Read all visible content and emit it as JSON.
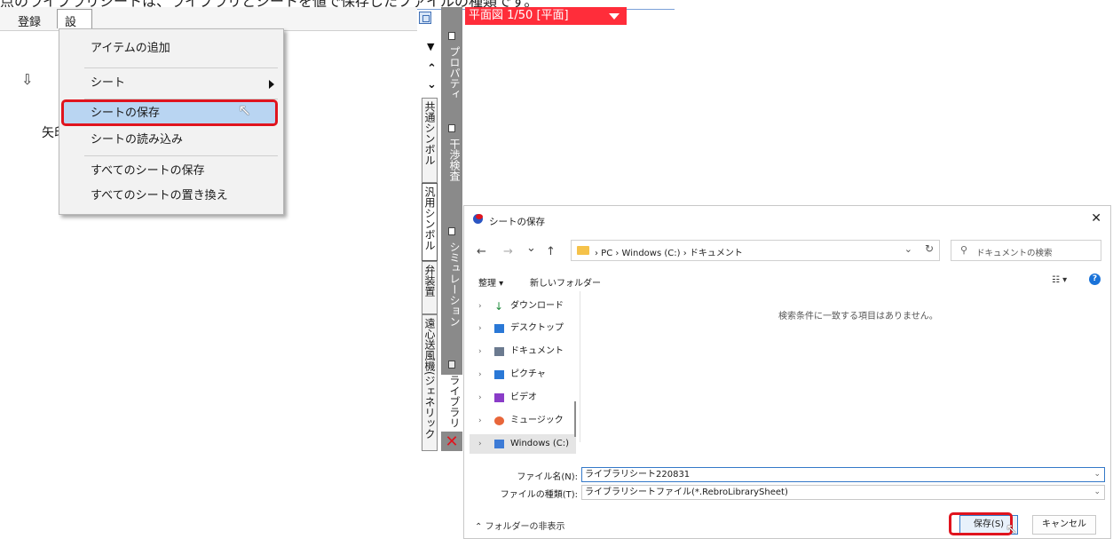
{
  "caption": "点のライブラリシートは、ライブラリとシートを値で保存したファイルの種類です。",
  "menubar": {
    "register": "登録",
    "settings": "設定"
  },
  "dropdown": {
    "items": [
      {
        "label": "アイテムの追加"
      },
      {
        "label": "シート"
      },
      {
        "label": "シートの保存"
      },
      {
        "label": "シートの読み込み"
      },
      {
        "label": "すべてのシートの保存"
      },
      {
        "label": "すべてのシートの置き換え"
      }
    ]
  },
  "workspace": {
    "label_fragment": "矢印"
  },
  "side_tabs": {
    "items": [
      {
        "label": "共通シンボル"
      },
      {
        "label": "汎用シンボル"
      },
      {
        "label": "弁装置"
      },
      {
        "label": "遠心送風機(ジェネリック"
      }
    ]
  },
  "gray_panel": {
    "items": [
      {
        "label": "プロパティ"
      },
      {
        "label": "干渉検査"
      },
      {
        "label": "シミュレーション"
      },
      {
        "label": "ライブラリ"
      }
    ],
    "close_glyph": "✕"
  },
  "plan_tab": {
    "label": "平面図 1/50 [平面]"
  },
  "dialog": {
    "title": "シートの保存",
    "close_glyph": "✕",
    "nav": {
      "back": "←",
      "forward": "→",
      "recent": "⌄",
      "up": "↑"
    },
    "path": "› PC › Windows (C:) › ドキュメント",
    "search_placeholder": "ドキュメントの検索",
    "toolbar": {
      "organize": "整理 ▾",
      "new_folder": "新しいフォルダー",
      "view": "☷ ▾"
    },
    "nav_items": [
      {
        "label": "ダウンロード",
        "color": "#1e8a3c"
      },
      {
        "label": "デスクトップ",
        "color": "#2a78d6"
      },
      {
        "label": "ドキュメント",
        "color": "#6b7a8f"
      },
      {
        "label": "ピクチャ",
        "color": "#2a78d6"
      },
      {
        "label": "ビデオ",
        "color": "#8a3cc8"
      },
      {
        "label": "ミュージック",
        "color": "#e8663a"
      },
      {
        "label": "Windows (C:)",
        "color": "#3d7bd6"
      }
    ],
    "empty_message": "検索条件に一致する項目はありません。",
    "filename_label": "ファイル名(N):",
    "filename_value": "ライブラリシート220831",
    "filetype_label": "ファイルの種類(T):",
    "filetype_value": "ライブラリシートファイル(*.RebroLibrarySheet)",
    "hide_folders": "フォルダーの非表示",
    "save_button": "保存(S)",
    "cancel_button": "キャンセル"
  },
  "colors": {
    "accent_red": "#e0141e",
    "highlight_blue": "#b9d5f2",
    "plan_tab_red": "#ff2d3a"
  }
}
